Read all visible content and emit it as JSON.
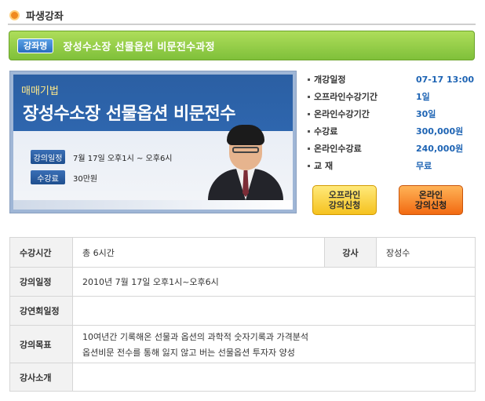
{
  "section": {
    "title": "파생강좌"
  },
  "course": {
    "badge": "강좌명",
    "name": "장성수소장 선물옵션 비문전수과정"
  },
  "banner": {
    "tag": "매매기법",
    "title": "장성수소장 선물옵션 비문전수",
    "rows": [
      {
        "label": "강의일정",
        "value": "7월 17일 오후1시 ~ 오후6시"
      },
      {
        "label": "수강료",
        "value": "30만원"
      }
    ]
  },
  "info": [
    {
      "label": "개강일정",
      "value": "07-17 13:00"
    },
    {
      "label": "오프라인수강기간",
      "value": "1일"
    },
    {
      "label": "온라인수강기간",
      "value": "30일"
    },
    {
      "label": "수강료",
      "value": "300,000원"
    },
    {
      "label": "온라인수강료",
      "value": "240,000원"
    },
    {
      "label": "교  재",
      "value": "무료"
    }
  ],
  "buttons": {
    "offline_line1": "오프라인",
    "offline_line2": "강의신청",
    "online_line1": "온라인",
    "online_line2": "강의신청"
  },
  "details": {
    "time_label": "수강시간",
    "time_value": "총 6시간",
    "instructor_label": "강사",
    "instructor_value": "장성수",
    "schedule_label": "강의일정",
    "schedule_value": "2010년 7월 17일 오후1시~오후6시",
    "session_label": "강연회일정",
    "session_value": "",
    "goal_label": "강의목표",
    "goal_line1": "10여년간 기록해온 선물과 옵션의 과학적 숫자기록과 가격분석",
    "goal_line2": "옵션비문 전수를 통해 잃지 않고 버는 선물옵션 투자자 양성",
    "intro_label": "강사소개",
    "intro_value": ""
  },
  "colors": {
    "accent_green": "#8cc63f",
    "value_blue": "#1e64b4",
    "offline_btn": "#f5c21f",
    "online_btn": "#f26a12"
  }
}
